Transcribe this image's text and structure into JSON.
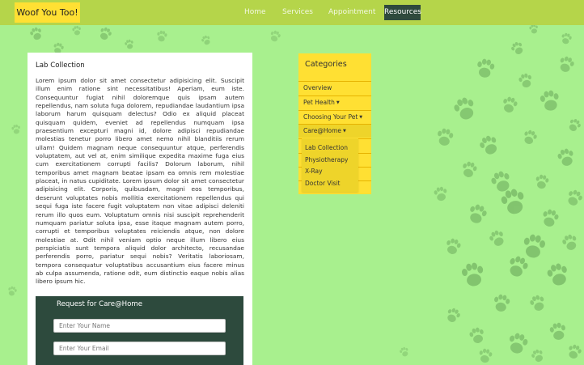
{
  "navbar": {
    "brand": "Woof You Too!",
    "links": [
      "Home",
      "Services",
      "Appointment"
    ],
    "active_link": "Resources"
  },
  "article": {
    "title": "Lab Collection",
    "body": "Lorem ipsum dolor sit amet consectetur adipisicing elit. Suscipit illum enim ratione sint necessitatibus! Aperiam, eum iste. Consequuntur fugiat nihil doloremque quis ipsam autem repellendus, nam soluta fuga dolorem, repudiandae laudantium ipsa laborum harum quisquam delectus? Odio ex aliquid placeat quisquam quidem, eveniet ad repellendus numquam ipsa praesentium excepturi magni id, dolore adipisci repudiandae molestias tenetur porro libero amet nemo nihil blanditiis rerum ullam! Quidem magnam neque consequuntur atque, perferendis voluptatem, aut vel at, enim similique expedita maxime fuga eius cum exercitationem corrupti facilis? Dolorum laborum, nihil temporibus amet magnam beatae ipsam ea omnis rem molestiae placeat, in natus cupiditate. Lorem ipsum dolor sit amet consectetur adipisicing elit. Corporis, quibusdam, magni eos temporibus, deserunt voluptates nobis mollitia exercitationem repellendus qui sequi fuga iste facere fugit voluptatem non vitae adipisci deleniti rerum illo quos eum. Voluptatum omnis nisi suscipit reprehenderit numquam pariatur soluta ipsa, esse itaque magnam autem porro, corrupti et temporibus voluptates reiciendis atque, non dolore molestiae at. Odit nihil veniam optio neque illum libero eius perspiciatis sunt tempora aliquid dolor architecto, recusandae perferendis porro, pariatur sequi nobis? Veritatis laboriosam, tempora consequatur voluptatibus accusantium eius facere minus ab culpa assumenda, ratione odit, eum distinctio eaque nobis alias libero ipsum hic."
  },
  "form": {
    "title": "Request for Care@Home",
    "name_placeholder": "Enter Your Name",
    "name_value": "",
    "email_placeholder": "Enter Your Email",
    "email_value": ""
  },
  "categories": {
    "title": "Categories",
    "items": [
      {
        "label": "Overview",
        "caret": ""
      },
      {
        "label": "Pet Health",
        "caret": "▼"
      },
      {
        "label": "Choosing Your Pet",
        "caret": "▼"
      },
      {
        "label": "Care@Home",
        "caret": "▼"
      }
    ],
    "submenu": [
      "Lab Collection",
      "Physiotherapy",
      "X-Ray",
      "Doctor Visit"
    ]
  },
  "colors": {
    "page_background": "#a8f08e",
    "navbar": "#b5d54a",
    "brand_and_categories": "#ffe033",
    "dark_accent": "#2d4a3d",
    "paw_prints": "#6aa85a"
  },
  "icons": [
    "paw-print-icon",
    "caret-down-icon"
  ]
}
